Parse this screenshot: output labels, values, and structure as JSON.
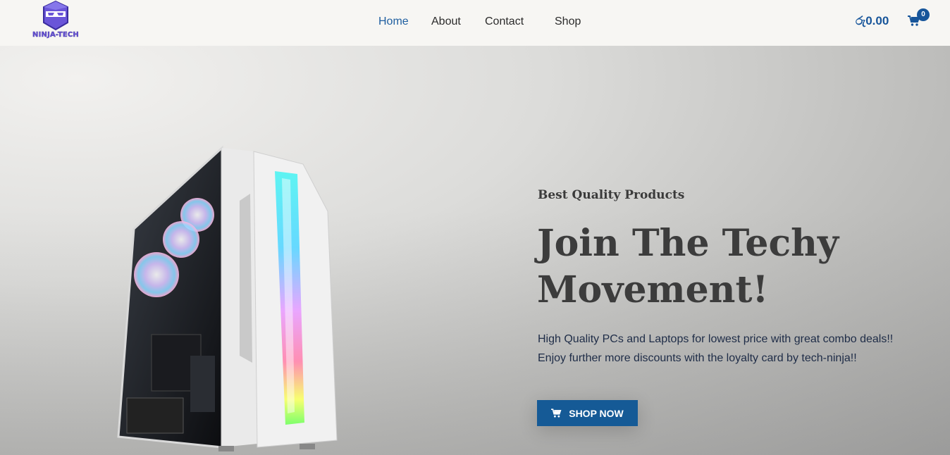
{
  "brand": {
    "logo_text": "NINJA-TECH"
  },
  "nav": {
    "items": [
      "Home",
      "About",
      "Contact",
      "Shop"
    ],
    "active": "Home"
  },
  "cart": {
    "total": "රු0.00",
    "count": "0",
    "icon": "cart-icon"
  },
  "hero": {
    "subtitle": "Best Quality Products",
    "title": "Join The Techy Movement!",
    "description": "High Quality PCs and Laptops for lowest price with great combo deals!! Enjoy further more discounts with the loyalty card by tech-ninja!!",
    "cta_label": "SHOP NOW",
    "cta_icon": "cart-icon"
  },
  "colors": {
    "accent": "#155a96",
    "nav_active": "#1f5fa0",
    "logo": "#6b55d6"
  }
}
